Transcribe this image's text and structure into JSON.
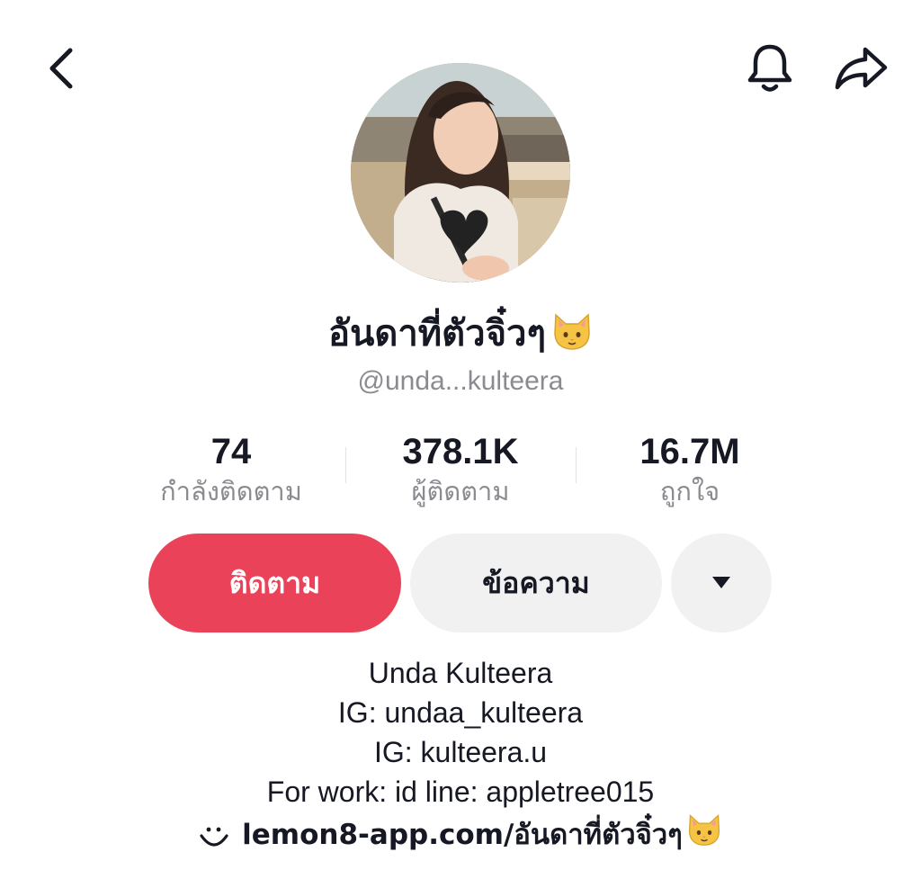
{
  "header": {
    "back_icon": "chevron-left-icon",
    "notification_icon": "bell-icon",
    "share_icon": "share-arrow-icon"
  },
  "profile": {
    "display_name": "อันดาที่ตัวจิ๋วๆ",
    "display_name_emoji": "cat-face-emoji",
    "handle": "@unda...kulteera"
  },
  "stats": [
    {
      "value": "74",
      "label": "กำลังติดตาม"
    },
    {
      "value": "378.1K",
      "label": "ผู้ติดตาม"
    },
    {
      "value": "16.7M",
      "label": "ถูกใจ"
    }
  ],
  "actions": {
    "follow_label": "ติดตาม",
    "message_label": "ข้อความ",
    "more_icon": "caret-down-icon"
  },
  "bio": {
    "lines": [
      "Unda Kulteera",
      "IG: undaa_kulteera",
      "IG: kulteera.u",
      "For work: id line: appletree015"
    ],
    "link_text": "lemon8-app.com/อันดาที่ตัวจิ๋วๆ",
    "link_icon": "lemon8-smile-icon",
    "link_emoji": "cat-face-emoji"
  },
  "colors": {
    "follow_button": "#ea4359",
    "secondary_button": "#f1f1f2",
    "text_primary": "#161823",
    "text_secondary": "#8a8b91"
  }
}
